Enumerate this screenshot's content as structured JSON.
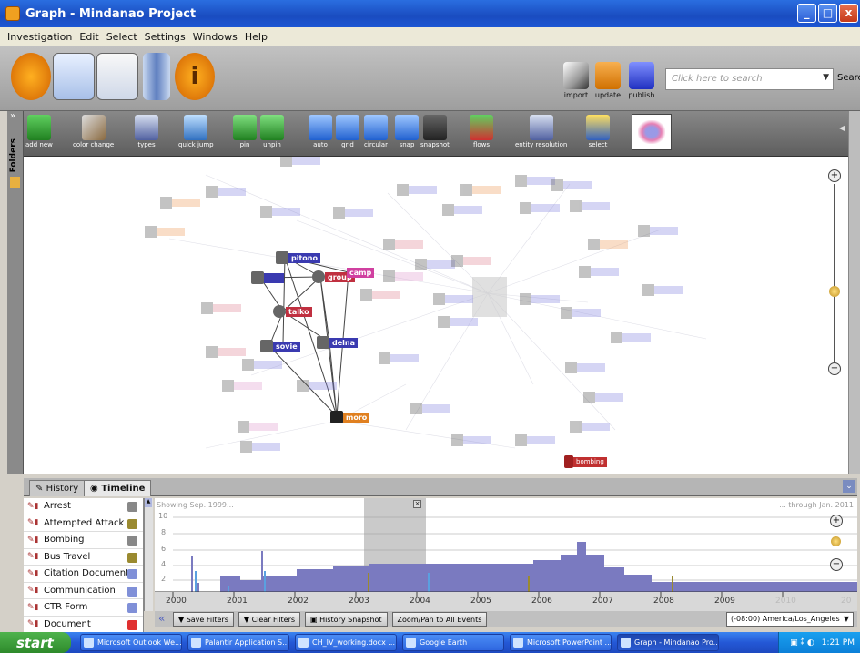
{
  "window": {
    "title": "Graph - Mindanao Project"
  },
  "menu": [
    "Investigation",
    "Edit",
    "Select",
    "Settings",
    "Windows",
    "Help"
  ],
  "top_actions": [
    {
      "label": "import",
      "icon": "import-icon"
    },
    {
      "label": "update",
      "icon": "update-arrow-icon"
    },
    {
      "label": "publish",
      "icon": "publish-arrow-icon"
    }
  ],
  "search": {
    "placeholder": "Click here to search",
    "button_label": "Search"
  },
  "left_strip": {
    "label": "Folders"
  },
  "toolbar": [
    {
      "label": "add new",
      "icon": "add-new-icon"
    },
    {
      "label": "color change",
      "icon": "brush-icon"
    },
    {
      "label": "types",
      "icon": "types-icon"
    },
    {
      "label": "quick jump",
      "icon": "quick-jump-icon"
    },
    {
      "label": "pin",
      "icon": "pin-icon"
    },
    {
      "label": "unpin",
      "icon": "unpin-icon"
    },
    {
      "label": "auto",
      "icon": "auto-layout-icon"
    },
    {
      "label": "grid",
      "icon": "grid-layout-icon"
    },
    {
      "label": "circular",
      "icon": "circular-layout-icon"
    },
    {
      "label": "snap",
      "icon": "snap-layout-icon"
    },
    {
      "label": "snapshot",
      "icon": "camera-icon"
    },
    {
      "label": "flows",
      "icon": "flows-icon"
    },
    {
      "label": "entity resolution",
      "icon": "entity-resolution-icon"
    },
    {
      "label": "select",
      "icon": "select-icon"
    }
  ],
  "graph": {
    "labeled_nodes": [
      {
        "label": "pitono",
        "color": "#3a3ab0"
      },
      {
        "label": "group",
        "color": "#c03040"
      },
      {
        "label": "camp",
        "color": "#d040a0"
      },
      {
        "label": "talko",
        "color": "#c03040"
      },
      {
        "label": "sovie",
        "color": "#3a3ab0"
      },
      {
        "label": "delna",
        "color": "#3a3ab0"
      },
      {
        "label": "moro",
        "color": "#e08020"
      },
      {
        "label": "bombing",
        "color": "#c03030"
      }
    ]
  },
  "bottom_tabs": [
    {
      "label": "History",
      "icon": "history-icon"
    },
    {
      "label": "Timeline",
      "icon": "timeline-icon"
    }
  ],
  "events": [
    {
      "label": "Arrest",
      "color": "#888888"
    },
    {
      "label": "Attempted Attack",
      "color": "#9a8a30"
    },
    {
      "label": "Bombing",
      "color": "#888888"
    },
    {
      "label": "Bus Travel",
      "color": "#9a8a30"
    },
    {
      "label": "Citation Document",
      "color": "#8090d8"
    },
    {
      "label": "Communication",
      "color": "#8090d8"
    },
    {
      "label": "CTR Form",
      "color": "#8090d8"
    },
    {
      "label": "Document",
      "color": "#e03030"
    }
  ],
  "timeline": {
    "showing": "Showing Sep. 1999...",
    "through": "... through Jan. 2011",
    "y_ticks": [
      "10",
      "8",
      "6",
      "4",
      "2"
    ],
    "years": [
      "2000",
      "2001",
      "2002",
      "2003",
      "2004",
      "2005",
      "2006",
      "2007",
      "2008",
      "2009",
      "2010",
      "20"
    ]
  },
  "timeline_controls": {
    "save_filters": "Save Filters",
    "clear_filters": "Clear Filters",
    "history_snapshot": "History Snapshot",
    "zoom_pan": "Zoom/Pan to All Events",
    "timezone": "(-08:00) America/Los_Angeles"
  },
  "taskbar": {
    "start": "start",
    "tasks": [
      "Microsoft Outlook We...",
      "Palantir Application S...",
      "CH_IV_working.docx ...",
      "Google Earth",
      "Microsoft PowerPoint ...",
      "Graph - Mindanao Pro..."
    ],
    "time": "1:21 PM"
  }
}
